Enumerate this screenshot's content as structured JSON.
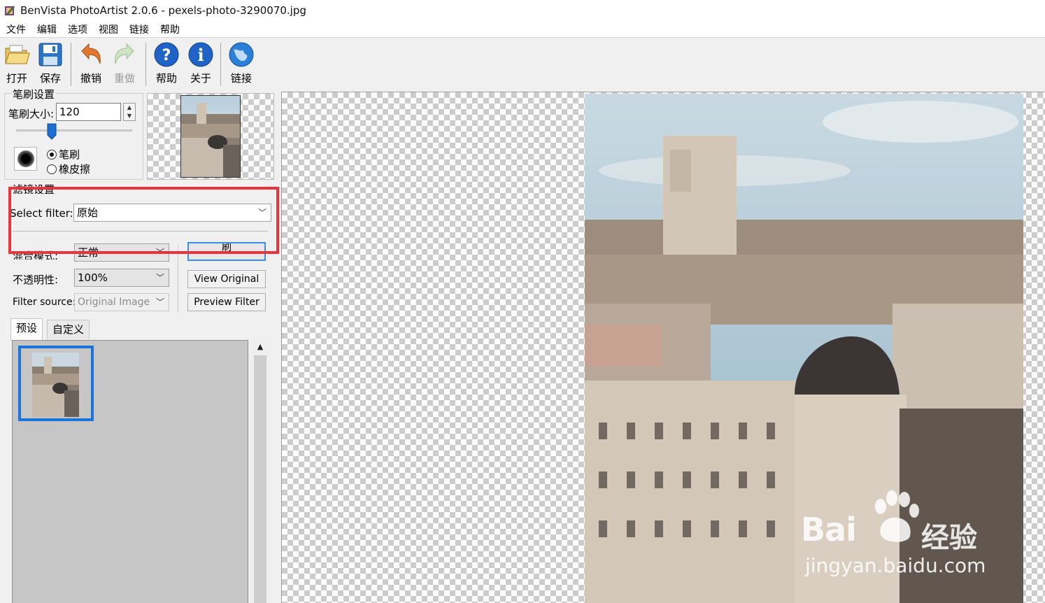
{
  "window": {
    "title": "BenVista PhotoArtist 2.0.6 - pexels-photo-3290070.jpg",
    "icon": "app-icon"
  },
  "menu": [
    "文件",
    "编辑",
    "选项",
    "视图",
    "链接",
    "帮助"
  ],
  "toolbar": {
    "open": {
      "label": "打开",
      "icon": "folder-open-icon"
    },
    "save": {
      "label": "保存",
      "icon": "floppy-disk-icon"
    },
    "undo": {
      "label": "撤销",
      "icon": "undo-arrow-icon"
    },
    "redo": {
      "label": "重做",
      "icon": "redo-arrow-icon",
      "enabled": false
    },
    "help": {
      "label": "帮助",
      "icon": "help-icon"
    },
    "about": {
      "label": "关于",
      "icon": "info-icon"
    },
    "link": {
      "label": "链接",
      "icon": "globe-icon"
    }
  },
  "brush": {
    "group_title": "笔刷设置",
    "size_label": "笔刷大小:",
    "size_value": "120",
    "mode_brush": "笔刷",
    "mode_eraser": "橡皮擦",
    "selected_mode": "笔刷"
  },
  "filter": {
    "group_title": "滤镜设置",
    "select_label": "Select filter:",
    "select_value": "原始",
    "blend_label": "混合模式:",
    "blend_value": "正常",
    "opacity_label": "不透明性:",
    "opacity_value": "100%",
    "source_label": "Filter source:",
    "source_value": "Original Image",
    "apply_button": "刷",
    "view_original_button": "View Original",
    "preview_filter_button": "Preview Filter"
  },
  "tabs": {
    "preset": "预设",
    "custom": "自定义",
    "active": "预设"
  },
  "watermark": {
    "brand": "Bai",
    "brand_cn": "经验",
    "url": "jingyan.baidu.com"
  },
  "colors": {
    "highlight_red": "#e8343a",
    "selection_blue": "#1d74d8",
    "default_button_border": "#3a8ee6"
  }
}
